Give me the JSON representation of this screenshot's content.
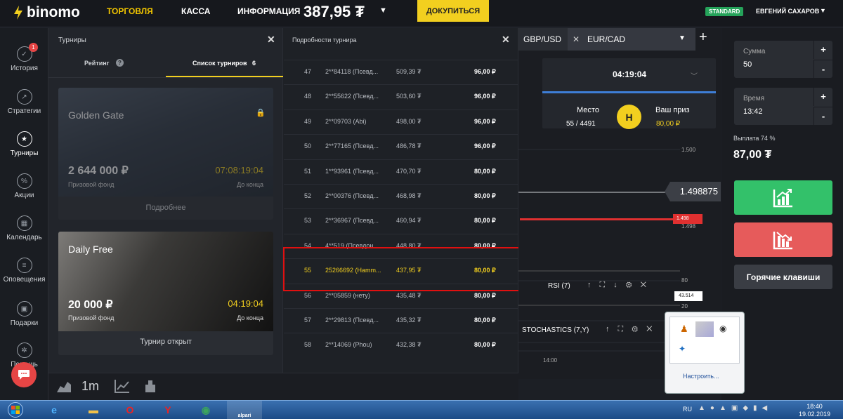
{
  "header": {
    "logo": "binomo",
    "nav_trade": "ТОРГОВЛЯ",
    "nav_cash": "КАССА",
    "nav_info": "ИНФОРМАЦИЯ",
    "balance": "387,95 ₮",
    "deposit_label": "ДОКУПИТЬСЯ",
    "account_badge": "STANDARD",
    "username": "ЕВГЕНИЙ САХАРОВ"
  },
  "sidebar": {
    "items": [
      {
        "label": "История",
        "badge": "1"
      },
      {
        "label": "Стратегии"
      },
      {
        "label": "Турниры"
      },
      {
        "label": "Акции"
      },
      {
        "label": "Календарь"
      },
      {
        "label": "Оповещения"
      },
      {
        "label": "Подарки"
      },
      {
        "label": "Помощь"
      }
    ]
  },
  "tournaments": {
    "title": "Турниры",
    "tab_rating": "Рейтинг",
    "tab_list": "Список турниров",
    "tab_list_count": "6",
    "cards": [
      {
        "name": "Golden Gate",
        "prize": "2 644 000 ₽",
        "prize_label": "Призовой фонд",
        "time": "07:08:19:04",
        "time_label": "До конца",
        "button": "Подробнее"
      },
      {
        "name": "Daily Free",
        "prize": "20 000 ₽",
        "prize_label": "Призовой фонд",
        "time": "04:19:04",
        "time_label": "До конца",
        "button": "Турнир открыт"
      }
    ]
  },
  "details": {
    "title": "Подробности турнира",
    "rows": [
      {
        "place": "47",
        "name": "2**84118 (Псевд...",
        "balance": "509,39 ₮",
        "prize": "96,00 ₽"
      },
      {
        "place": "48",
        "name": "2**55622 (Псевд...",
        "balance": "503,60 ₮",
        "prize": "96,00 ₽"
      },
      {
        "place": "49",
        "name": "2**09703 (Abi)",
        "balance": "498,00 ₮",
        "prize": "96,00 ₽"
      },
      {
        "place": "50",
        "name": "2**77165 (Псевд...",
        "balance": "486,78 ₮",
        "prize": "96,00 ₽"
      },
      {
        "place": "51",
        "name": "1**93961 (Псевд...",
        "balance": "470,70 ₮",
        "prize": "80,00 ₽"
      },
      {
        "place": "52",
        "name": "2**00376 (Псевд...",
        "balance": "468,98 ₮",
        "prize": "80,00 ₽"
      },
      {
        "place": "53",
        "name": "2**36967 (Псевд...",
        "balance": "460,94 ₮",
        "prize": "80,00 ₽"
      },
      {
        "place": "54",
        "name": "4**519 (Псевдон...",
        "balance": "448,80 ₮",
        "prize": "80,00 ₽"
      },
      {
        "place": "55",
        "name": "25266692 (Hamm...",
        "balance": "437,95 ₮",
        "prize": "80,00 ₽"
      },
      {
        "place": "56",
        "name": "2**05859 (нету)",
        "balance": "435,48 ₮",
        "prize": "80,00 ₽"
      },
      {
        "place": "57",
        "name": "2**29813 (Псевд...",
        "balance": "435,32 ₮",
        "prize": "80,00 ₽"
      },
      {
        "place": "58",
        "name": "2**14069 (Phou)",
        "balance": "432,38 ₮",
        "prize": "80,00 ₽"
      }
    ]
  },
  "chart": {
    "pair1": "GBP/USD",
    "pair2": "EUR/CAD",
    "timer": "04:19:04",
    "place_label": "Место",
    "place_value": "55 / 4491",
    "avatar_letter": "H",
    "prize_label": "Ваш приз",
    "prize_value": "80,00 ₽",
    "axis_top": "1.500",
    "current_price": "1.498875",
    "red_price": "1.498",
    "axis_mid": "1.498",
    "axis_80": "80",
    "rsi_label": "RSI (7)",
    "rsi_value": "43.514",
    "axis_20": "20",
    "stoch_label": "STOCHASTICS (7,Y)",
    "time_label": "14:00",
    "timeframe": "1m"
  },
  "trade": {
    "amount_label": "Сумма",
    "amount_value": "50",
    "time_label": "Время",
    "time_value": "13:42",
    "payout_label": "Выплата 74 %",
    "payout_value": "87,00 ₮",
    "hotkeys_label": "Горячие клавиши"
  },
  "popup": {
    "configure": "Настроить..."
  },
  "taskbar": {
    "lang": "RU",
    "time": "18:40",
    "date": "19.02.2019",
    "app_label": "alpari"
  }
}
